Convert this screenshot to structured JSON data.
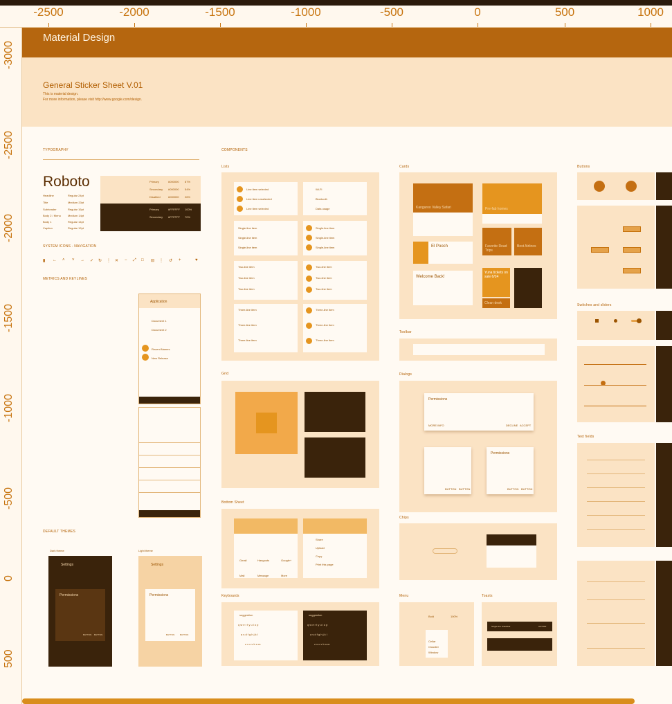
{
  "ruler": {
    "horizontal": [
      "-2500",
      "-2000",
      "-1500",
      "-1000",
      "-500",
      "0",
      "500",
      "1000"
    ],
    "vertical": [
      "-3000",
      "-2500",
      "-2000",
      "-1500",
      "-1000",
      "-500",
      "0",
      "500"
    ]
  },
  "header": {
    "title": "Material Design"
  },
  "intro": {
    "title": "General Sticker Sheet V.01",
    "line1": "This is material design.",
    "line2": "For more information, please visit http://www.google.com/design."
  },
  "sections": {
    "typography": "TYPOGRAPHY",
    "components": "COMPONENTS",
    "system_icons": "SYSTEM ICONS - NAVIGATION",
    "metrics": "METRICS AND KEYLINES",
    "default_themes": "DEFAULT THEMES",
    "lists": "Lists",
    "cards": "Cards",
    "buttons": "Buttons",
    "grid": "Grid",
    "dialogs": "Dialogs",
    "toolbar": "Toolbar",
    "switches": "Switches and sliders",
    "bottom_sheet": "Bottom Sheet",
    "chips": "Chips",
    "keyboards": "Keyboards",
    "menu": "Menu",
    "toasts": "Toasts",
    "text_fields": "Text fields"
  },
  "typography": {
    "font": "Roboto",
    "rows": [
      {
        "name": "Headline",
        "value": "Regular 24pt"
      },
      {
        "name": "Title",
        "value": "Medium 20pt"
      },
      {
        "name": "Subheader",
        "value": "Regular 16pt"
      },
      {
        "name": "Body 2 / Menu",
        "value": "Medium 14pt"
      },
      {
        "name": "Body 1",
        "value": "Regular 14pt"
      },
      {
        "name": "Caption",
        "value": "Regular 12pt"
      }
    ],
    "light_colors": [
      {
        "name": "Primary",
        "hex": "#000000",
        "pct": "87%"
      },
      {
        "name": "Secondary",
        "hex": "#000000",
        "pct": "54%"
      },
      {
        "name": "Disabled",
        "hex": "#000000",
        "pct": "26%"
      }
    ],
    "dark_colors": [
      {
        "name": "Primary",
        "hex": "#FFFFFF",
        "pct": "100%"
      },
      {
        "name": "Secondary",
        "hex": "#FFFFFF",
        "pct": "70%"
      },
      {
        "name": "Disabled",
        "hex": "#FFFFFF",
        "pct": "30%"
      }
    ]
  },
  "icons": [
    "menu-icon",
    "back-icon",
    "up-icon",
    "down-icon",
    "forward-icon",
    "check-icon",
    "refresh-icon",
    "more-icon",
    "close-icon",
    "minus-icon",
    "expand-icon",
    "fullscreen-icon",
    "collapse-icon",
    "apps-icon",
    "sync-icon",
    "add-icon",
    "favorite-icon"
  ],
  "app_screen": {
    "toolbar": "Application",
    "items": [
      "Document 1",
      "Document 2",
      "Recent Names",
      "New Release"
    ]
  },
  "themes": {
    "dark": "Dark theme",
    "light": "Light theme",
    "settings": "Settings",
    "dialog_title": "Permissions",
    "button1": "BUTTON",
    "button2": "BUTTON"
  },
  "lists": {
    "selected": [
      "Line item selected",
      "Line item unselected",
      "Line item selected"
    ],
    "wifi": [
      "Wi-Fi",
      "Bluetooth",
      "Data usage"
    ],
    "single": "Single-line item",
    "two": "Two-line item",
    "three": "Three-line item"
  },
  "cards": {
    "title1": "Kangaroo Valley Safari",
    "title2": "Pre-fab homes",
    "title3": "El Pooch",
    "title4": "Favorite Road Trips",
    "title5": "Best Airlines",
    "title6": "Welcome Back!",
    "title7": "Yuna tickets on sale 6/24",
    "title8": "Clean desk"
  },
  "dialog": {
    "title": "Permissions",
    "b1": "MORE INFO",
    "b2": "DECLINE",
    "b3": "ACCEPT",
    "b4": "BUTTON",
    "b5": "BUTTON"
  },
  "bottom_sheet": {
    "apps": [
      "Gmail",
      "Hangouts",
      "Google+",
      "Mail",
      "Message",
      "More"
    ],
    "actions": [
      "Share",
      "Upload",
      "Copy",
      "Print this page"
    ]
  },
  "keyboard": {
    "suggestion": "suggestion",
    "rows": [
      "q w e r t y u i o p",
      "a s d f g h j k l",
      "z x c v b n m"
    ]
  },
  "menu": {
    "items": [
      "Cellar",
      "Cloudier",
      "Window"
    ],
    "value1": "Bold",
    "value2": "100%"
  },
  "toasts": {
    "line1": "Single-line Snackbar",
    "action": "ACTION"
  },
  "colors": {
    "header": "#b5660f",
    "panel": "#fbe3c4",
    "dark": "#3a230b",
    "accent": "#e5951f"
  }
}
